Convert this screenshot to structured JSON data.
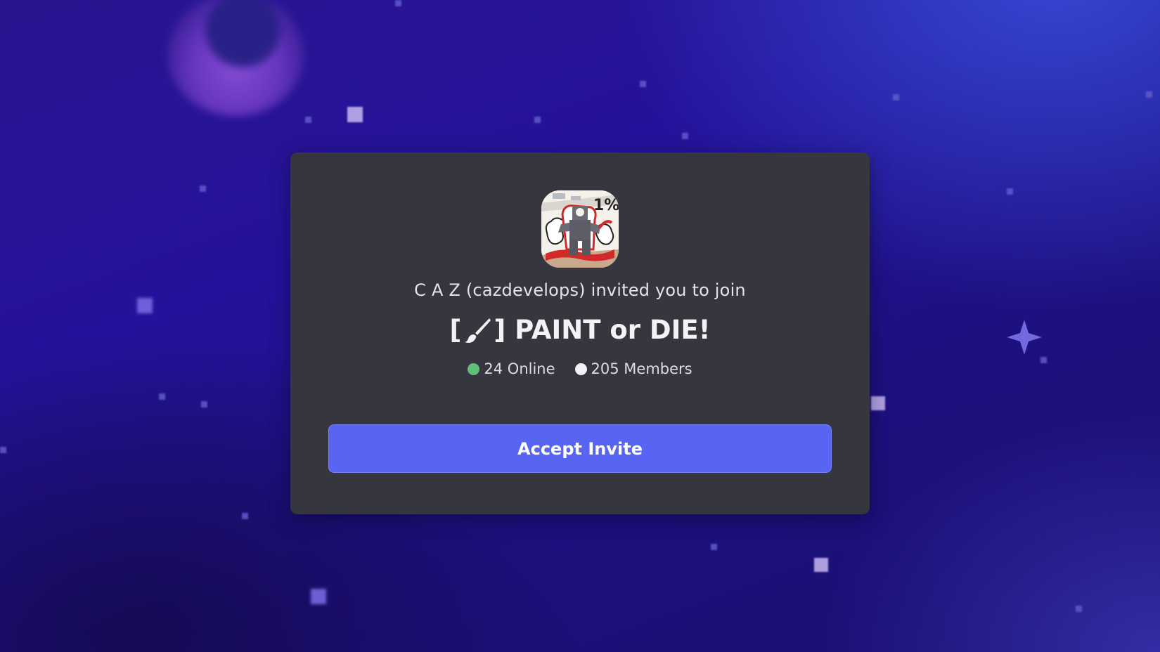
{
  "invite": {
    "inviter_text": "C A Z (cazdevelops) invited you to join",
    "server_name_prefix": "[",
    "server_name_suffix": "] PAINT or DIE!",
    "server_icon_badge": "1%",
    "online_count_text": "24 Online",
    "member_count_text": "205 Members",
    "accept_label": "Accept Invite"
  },
  "colors": {
    "card_background": "#36373e",
    "accept_button": "#5865f2",
    "online_dot": "#5ec07a",
    "members_dot": "#f2f3f5"
  },
  "icons": {
    "server_icon": "server-avatar-icon",
    "brush": "paintbrush-icon",
    "online": "online-dot-icon",
    "members": "members-dot-icon"
  }
}
